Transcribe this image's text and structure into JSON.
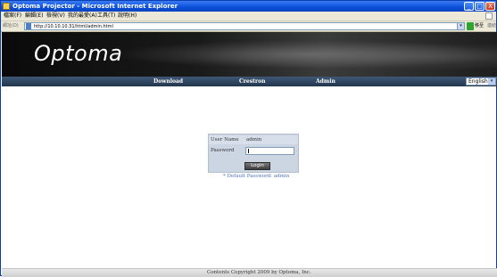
{
  "window": {
    "title": "Optoma Projector - Microsoft Internet Explorer",
    "minimize_glyph": "_",
    "maximize_glyph": "□",
    "close_glyph": "X"
  },
  "menu": {
    "items": [
      "檔案(F)",
      "編輯(E)",
      "檢視(V)",
      "我的最愛(A)",
      "工具(T)",
      "說明(H)"
    ]
  },
  "address_bar": {
    "label": "網址(D)",
    "url": "http://10.10.10.31/html/admin.html",
    "go_label": "移至",
    "links_label": "連結"
  },
  "banner": {
    "logo_text": "Optoma"
  },
  "nav": {
    "items": [
      "Download",
      "Crestron",
      "Admin"
    ],
    "language": "English"
  },
  "login": {
    "username_label": "User Name",
    "username_value": "admin",
    "password_label": "Password",
    "button_label": "Login",
    "hint": "* Default Password: admin"
  },
  "footer": {
    "text": "Contents Copyright 2009 by Optoma, Inc."
  },
  "colors": {
    "titlebar": "#0a4fd8",
    "nav_background": "#2d4561",
    "login_panel": "#ccd6e3",
    "hint_text": "#4a73b8"
  }
}
